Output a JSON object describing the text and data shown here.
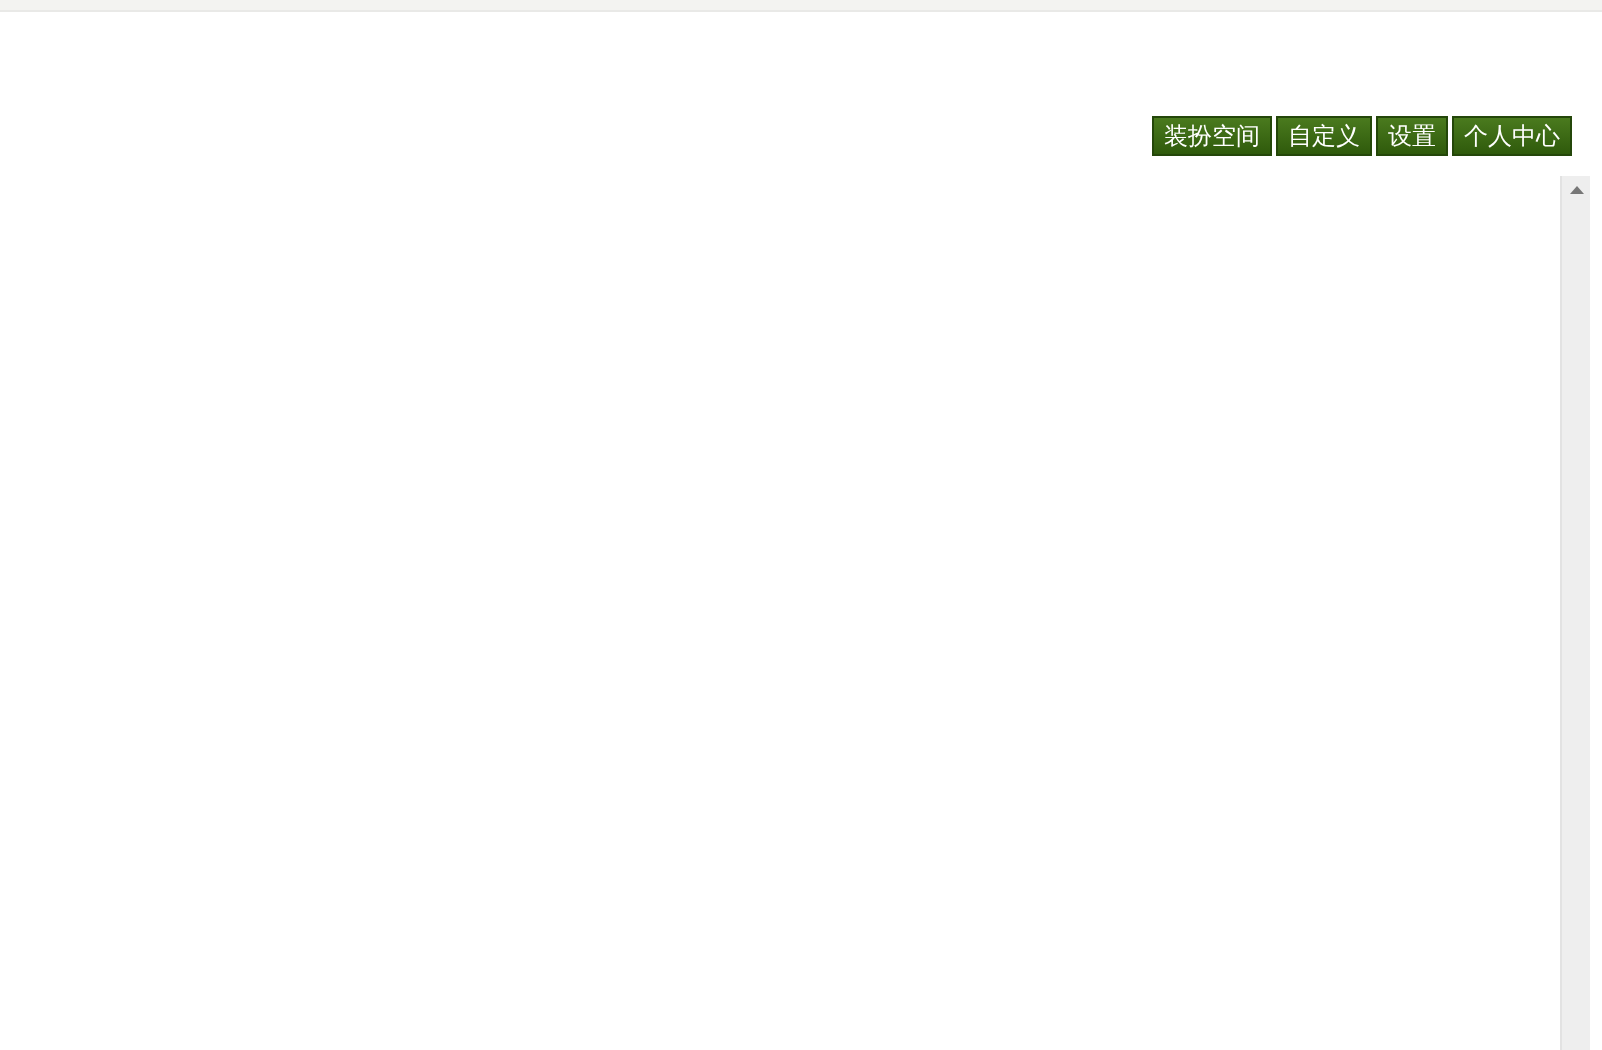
{
  "toolbar": {
    "buttons": [
      {
        "label": "装扮空间"
      },
      {
        "label": "自定义"
      },
      {
        "label": "设置"
      },
      {
        "label": "个人中心"
      }
    ]
  }
}
